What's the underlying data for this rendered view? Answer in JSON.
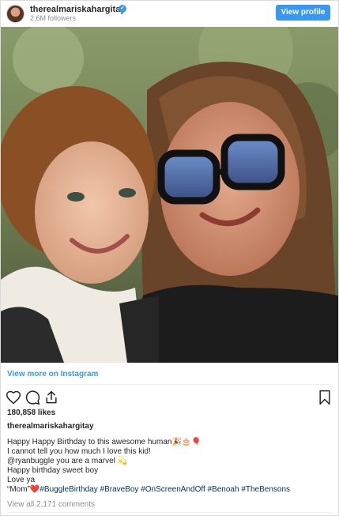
{
  "header": {
    "username": "therealmariskahargitay",
    "verified_badge": "✓",
    "followers": "2.6M followers",
    "view_profile_label": "View profile"
  },
  "photo": {
    "description": ""
  },
  "links": {
    "view_more": "View more on Instagram",
    "view_comments": "View all 2,171 comments"
  },
  "actions": {
    "icons": [
      "heart-icon",
      "comment-icon",
      "share-icon",
      "bookmark-icon"
    ]
  },
  "likes": "180,858 likes",
  "caption": {
    "username": "therealmariskahargitay",
    "lines": [
      "Happy Happy Birthday to this awesome human🎉🎂🎈",
      "I cannot tell you how much I love this kid!",
      "@ryanbuggle you are a marvel 💫",
      "Happy birthday sweet boy",
      "Love ya",
      "“Mom”❤️"
    ],
    "hashtags": "#BuggleBirthday #BraveBoy #OnScreenAndOff #Benoah #TheBensons"
  },
  "colors": {
    "accent": "#3897f0",
    "hashtag": "#003569",
    "muted": "#8e8e8e"
  }
}
